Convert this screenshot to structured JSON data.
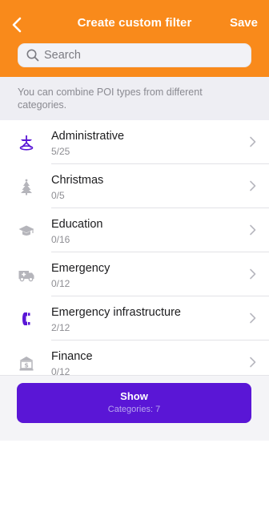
{
  "colors": {
    "accent": "#f98a1b",
    "primary_button": "#5a16d6",
    "icon_purple": "#5a16d6",
    "icon_gray": "#b5b5bb"
  },
  "header": {
    "title": "Create custom filter",
    "save_label": "Save",
    "back_icon": "chevron-left-icon"
  },
  "search": {
    "placeholder": "Search",
    "value": ""
  },
  "hint": "You can combine POI types from different categories.",
  "categories": [
    {
      "name": "Administrative",
      "count": "5/25",
      "icon": "town-hall-icon"
    },
    {
      "name": "Christmas",
      "count": "0/5",
      "icon": "christmas-tree-icon"
    },
    {
      "name": "Education",
      "count": "0/16",
      "icon": "graduation-cap-icon"
    },
    {
      "name": "Emergency",
      "count": "0/12",
      "icon": "ambulance-icon"
    },
    {
      "name": "Emergency infrastructure",
      "count": "2/12",
      "icon": "emergency-phone-icon"
    },
    {
      "name": "Finance",
      "count": "0/12",
      "icon": "bank-icon"
    }
  ],
  "show_button": {
    "label": "Show",
    "subtitle": "Categories: 7"
  }
}
